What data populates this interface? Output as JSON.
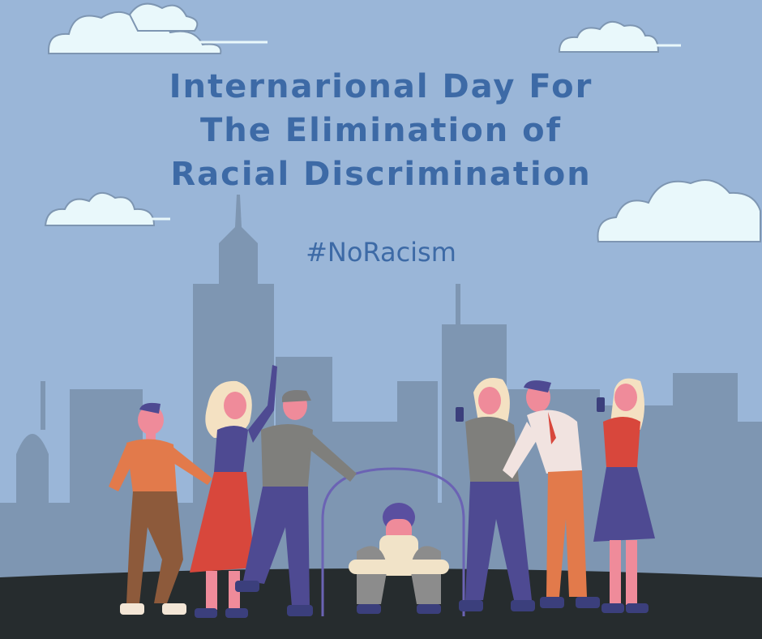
{
  "poster": {
    "title_lines": [
      "Internarional Day For",
      "The Elimination of",
      "Racial Discrimination"
    ],
    "hashtag": "#NoRacism"
  },
  "colors": {
    "sky": "#9ab6d8",
    "title": "#3d6aa6",
    "skyline": "#7e96b2",
    "ground": "#262c2e",
    "cloud": "#e9f8fb"
  }
}
